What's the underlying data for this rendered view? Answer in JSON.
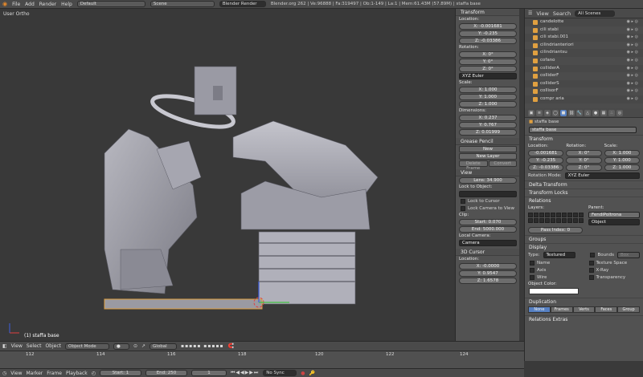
{
  "topbar": {
    "menus": [
      "File",
      "Add",
      "Render",
      "Help"
    ],
    "screen": "Default",
    "scene": "Scene",
    "engine": "Blender Render",
    "stats": "Blender.org 262 | Ve:96888 | Fa:319497 | Ob:1-149 | La:1 | Mem:61.43M (57.89M) | staffa base"
  },
  "viewport": {
    "title": "User Ortho",
    "selected": "(1) staffa base"
  },
  "npanel": {
    "transform_title": "Transform",
    "location_label": "Location:",
    "location": [
      "X: -0.001681",
      "Y: -0.235",
      "Z: -0.03386"
    ],
    "rotation_label": "Rotation:",
    "rotation": [
      "X: 0°",
      "Y: 0°",
      "Z: 0°"
    ],
    "rotation_mode": "XYZ Euler",
    "scale_label": "Scale:",
    "scale": [
      "X: 1.000",
      "Y: 1.000",
      "Z: 1.000"
    ],
    "dimensions_label": "Dimensions:",
    "dimensions": [
      "X: 0.237",
      "Y: 0.767",
      "Z: 0.01999"
    ],
    "grease_title": "Grease Pencil",
    "grease_new": "New",
    "grease_new_layer": "New Layer",
    "grease_delete": "Delete Frame",
    "grease_convert": "Convert",
    "view_title": "View",
    "lens": "Lens: 34.900",
    "lock_object": "Lock to Object:",
    "lock_cursor": "Lock to Cursor",
    "lock_camera": "Lock Camera to View",
    "clip_label": "Clip:",
    "clip_start": "Start: 0.070",
    "clip_end": "End: 5000.000",
    "local_camera": "Local Camera:",
    "camera": "Camera",
    "cursor_title": "3D Cursor",
    "cursor_location": "Location:",
    "cursor": [
      "X: -0.0000",
      "Y: 0.9547",
      "Z: 1.6578"
    ]
  },
  "outliner": {
    "view": "View",
    "search": "Search",
    "scope": "All Scenes",
    "items": [
      "candelotte",
      "cili stabi",
      "cili stabi.001",
      "cilindrianteriori",
      "cilindriantsu",
      "cofano",
      "colliderA",
      "colliderF",
      "colliderS",
      "collisorF",
      "compr aria"
    ]
  },
  "props": {
    "object_name": "staffa base",
    "name_field": "staffa base",
    "transform_title": "Transform",
    "location_label": "Location:",
    "rotation_label": "Rotation:",
    "scale_label": "Scale:",
    "location": [
      "-0.001681",
      "Y: -0.235",
      "Z: -0.03386"
    ],
    "rotation": [
      "X: 0°",
      "Y: 0°",
      "Z: 0°"
    ],
    "scale": [
      "X: 1.000",
      "Y: 1.000",
      "Z: 1.000"
    ],
    "rotation_mode_label": "Rotation Mode:",
    "rotation_mode": "XYZ Euler",
    "delta": "Delta Transform",
    "locks": "Transform Locks",
    "relations": "Relations",
    "layers_label": "Layers:",
    "parent_label": "Parent:",
    "parent": "FendiPoltrona",
    "parent_type": "Object",
    "pass_index": "Pass Index: 0",
    "groups": "Groups",
    "display": "Display",
    "type_label": "Type:",
    "type_value": "Textured",
    "bounds": "Bounds",
    "bounds_value": "Box",
    "name_chk": "Name",
    "texture_space": "Texture Space",
    "axis": "Axis",
    "xray": "X-Ray",
    "wire": "Wire",
    "transparency": "Transparency",
    "object_color": "Object Color:",
    "duplication": "Duplication",
    "dup_tabs": [
      "None",
      "Frames",
      "Verts",
      "Faces",
      "Group"
    ],
    "relations_extras": "Relations Extras"
  },
  "header3d": {
    "view": "View",
    "select": "Select",
    "object": "Object",
    "mode": "Object Mode",
    "orientation": "Global"
  },
  "timeline": {
    "ticks": [
      "112",
      "114",
      "116",
      "118",
      "120",
      "122",
      "124"
    ],
    "view": "View",
    "marker": "Marker",
    "frame": "Frame",
    "playback": "Playback",
    "start": "Start: 1",
    "end": "End: 250",
    "current": "1",
    "sync": "No Sync"
  },
  "colors": {
    "accent": "#5680c2",
    "background": "#393939",
    "object_highlight": "#e0a040"
  }
}
